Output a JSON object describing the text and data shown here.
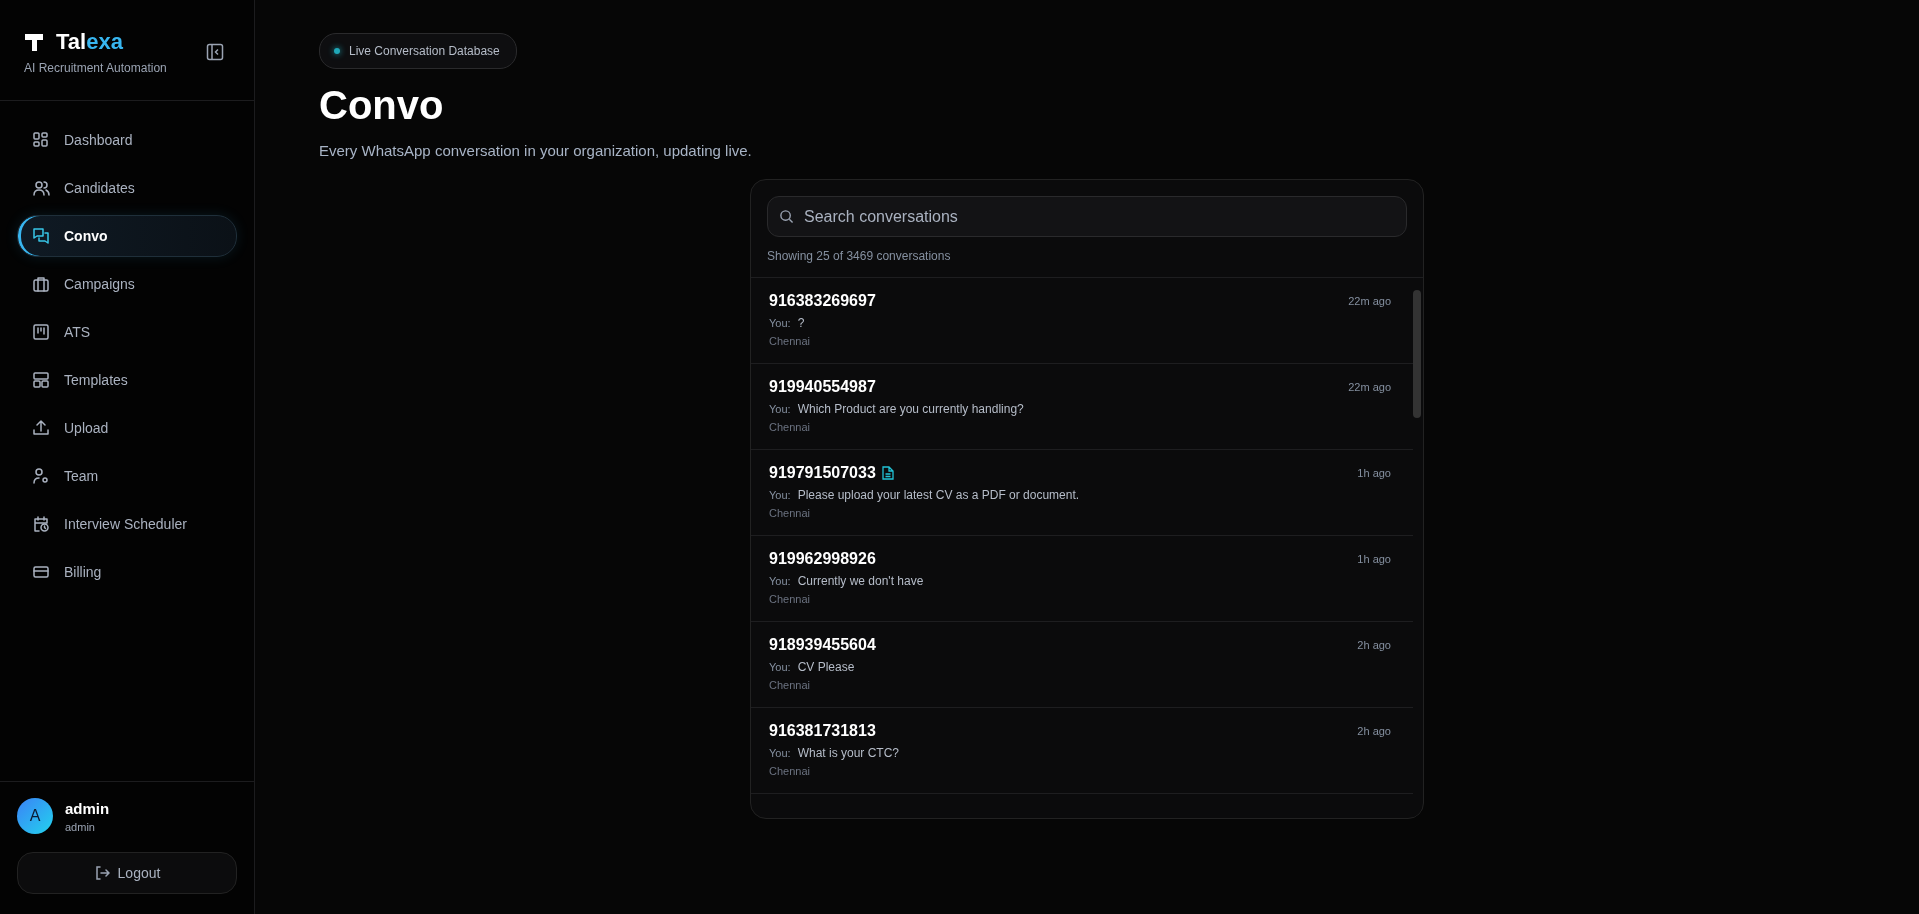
{
  "brand": {
    "name_start": "Tal",
    "name_end": "exa",
    "tagline": "AI Recruitment Automation"
  },
  "sidebar": {
    "items": [
      {
        "label": "Dashboard",
        "selected": false
      },
      {
        "label": "Candidates",
        "selected": false
      },
      {
        "label": "Convo",
        "selected": true
      },
      {
        "label": "Campaigns",
        "selected": false
      },
      {
        "label": "ATS",
        "selected": false
      },
      {
        "label": "Templates",
        "selected": false
      },
      {
        "label": "Upload",
        "selected": false
      },
      {
        "label": "Team",
        "selected": false
      },
      {
        "label": "Interview Scheduler",
        "selected": false
      },
      {
        "label": "Billing",
        "selected": false
      }
    ]
  },
  "user": {
    "initial": "A",
    "name": "admin",
    "role": "admin",
    "logout": "Logout"
  },
  "header": {
    "badge": "Live Conversation Database",
    "title": "Convo",
    "subtitle": "Every WhatsApp conversation in your organization, updating live."
  },
  "search": {
    "placeholder": "Search conversations"
  },
  "result_count": "Showing 25 of 3469 conversations",
  "conversations": [
    {
      "phone": "916383269697",
      "attachment": false,
      "sender": "You:",
      "message": "?",
      "location": "Chennai",
      "time": "22m ago"
    },
    {
      "phone": "919940554987",
      "attachment": false,
      "sender": "You:",
      "message": "Which Product are you currently handling?",
      "location": "Chennai",
      "time": "22m ago"
    },
    {
      "phone": "919791507033",
      "attachment": true,
      "sender": "You:",
      "message": "Please upload your latest CV as a PDF or document.",
      "location": "Chennai",
      "time": "1h ago"
    },
    {
      "phone": "919962998926",
      "attachment": false,
      "sender": "You:",
      "message": "Currently we don't have",
      "location": "Chennai",
      "time": "1h ago"
    },
    {
      "phone": "918939455604",
      "attachment": false,
      "sender": "You:",
      "message": "CV Please",
      "location": "Chennai",
      "time": "2h ago"
    },
    {
      "phone": "916381731813",
      "attachment": false,
      "sender": "You:",
      "message": "What is your CTC?",
      "location": "Chennai",
      "time": "2h ago"
    }
  ]
}
